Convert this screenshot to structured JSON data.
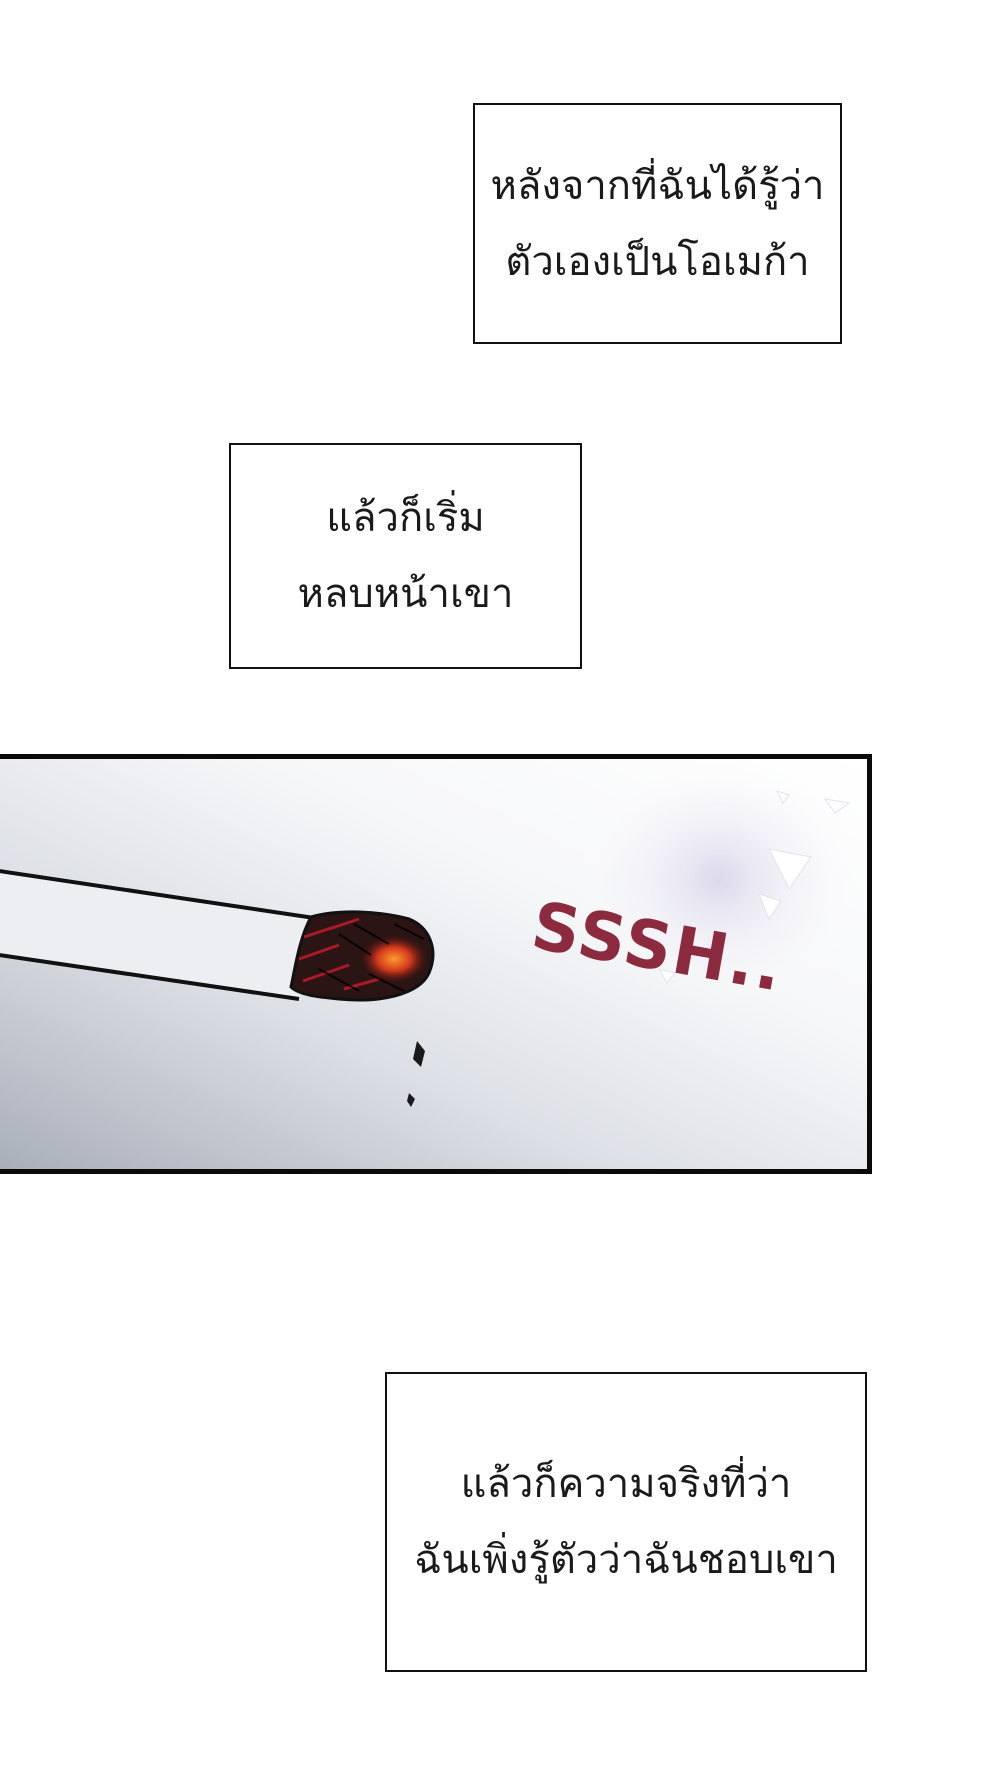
{
  "captions": {
    "first": {
      "line1": "หลังจากที่ฉันได้รู้ว่า",
      "line2": "ตัวเองเป็นโอเมก้า"
    },
    "second": {
      "line1": "แล้วก็เริ่ม",
      "line2": "หลบหน้าเขา"
    },
    "third": {
      "line1": "แล้วก็ความจริงที่ว่า",
      "line2": "ฉันเพิ่งรู้ตัวว่าฉันชอบเขา"
    }
  },
  "panel": {
    "sound_effect": "SSSH..",
    "sound_effect_color": "#8c2a3f",
    "border_color": "#0a0a0a"
  }
}
